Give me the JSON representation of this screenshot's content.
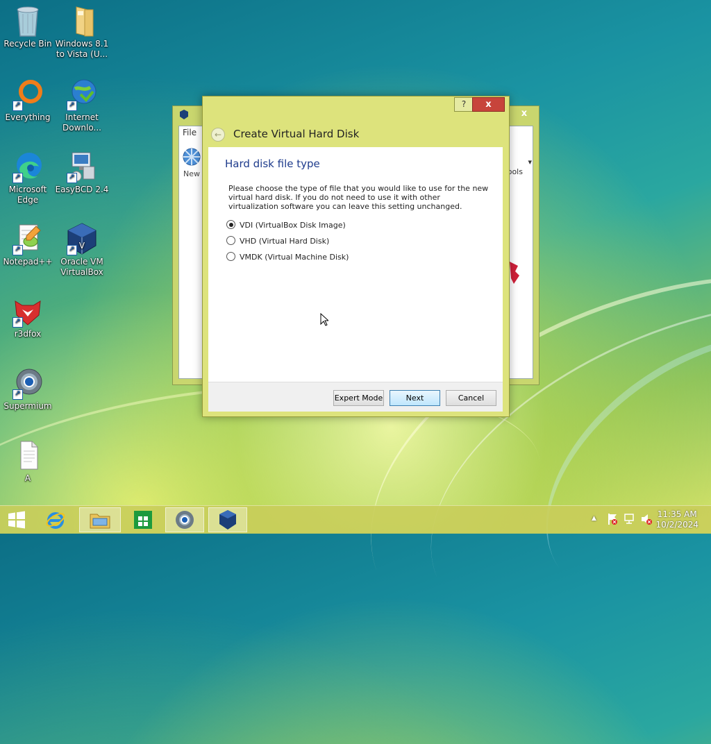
{
  "desktop": {
    "icons": [
      {
        "label": "Recycle Bin",
        "icon": "recycle-bin-icon"
      },
      {
        "label": "Windows 8.1 to Vista (U...",
        "icon": "folder-icon"
      },
      {
        "label": "Everything",
        "icon": "everything-icon"
      },
      {
        "label": "Internet Downlo...",
        "icon": "internet-download-manager-icon"
      },
      {
        "label": "Microsoft Edge",
        "icon": "edge-icon"
      },
      {
        "label": "EasyBCD 2.4",
        "icon": "easybcd-icon"
      },
      {
        "label": "Notepad++",
        "icon": "notepad-plus-plus-icon"
      },
      {
        "label": "Oracle VM VirtualBox",
        "icon": "virtualbox-icon"
      },
      {
        "label": "r3dfox",
        "icon": "r3dfox-icon"
      },
      {
        "label": "Supermium",
        "icon": "supermium-icon"
      },
      {
        "label": "A",
        "icon": "text-file-icon"
      }
    ]
  },
  "manager": {
    "menu_file": "File",
    "new_label": "New",
    "tools_label": "ools",
    "close_glyph": "x"
  },
  "dialog": {
    "title": "Create Virtual Hard Disk",
    "help_glyph": "?",
    "close_glyph": "x",
    "back_glyph": "←",
    "heading": "Hard disk file type",
    "description": "Please choose the type of file that you would like to use for the new virtual hard disk. If you do not need to use it with other virtualization software you can leave this setting unchanged.",
    "options": [
      {
        "label": "VDI (VirtualBox Disk Image)",
        "selected": true
      },
      {
        "label": "VHD (Virtual Hard Disk)",
        "selected": false
      },
      {
        "label": "VMDK (Virtual Machine Disk)",
        "selected": false
      }
    ],
    "buttons": {
      "expert": "Expert Mode",
      "next": "Next",
      "cancel": "Cancel"
    }
  },
  "taskbar": {
    "items": [
      "start-icon",
      "internet-explorer-icon",
      "file-explorer-icon",
      "store-icon",
      "supermium-icon",
      "virtualbox-icon"
    ],
    "tray_arrow": "▲",
    "time": "11:35 AM",
    "date": "10/2/2024"
  },
  "colors": {
    "dialog_frame": "#dde37c",
    "heading_blue": "#1e3b8c",
    "close_red": "#c7443b"
  }
}
